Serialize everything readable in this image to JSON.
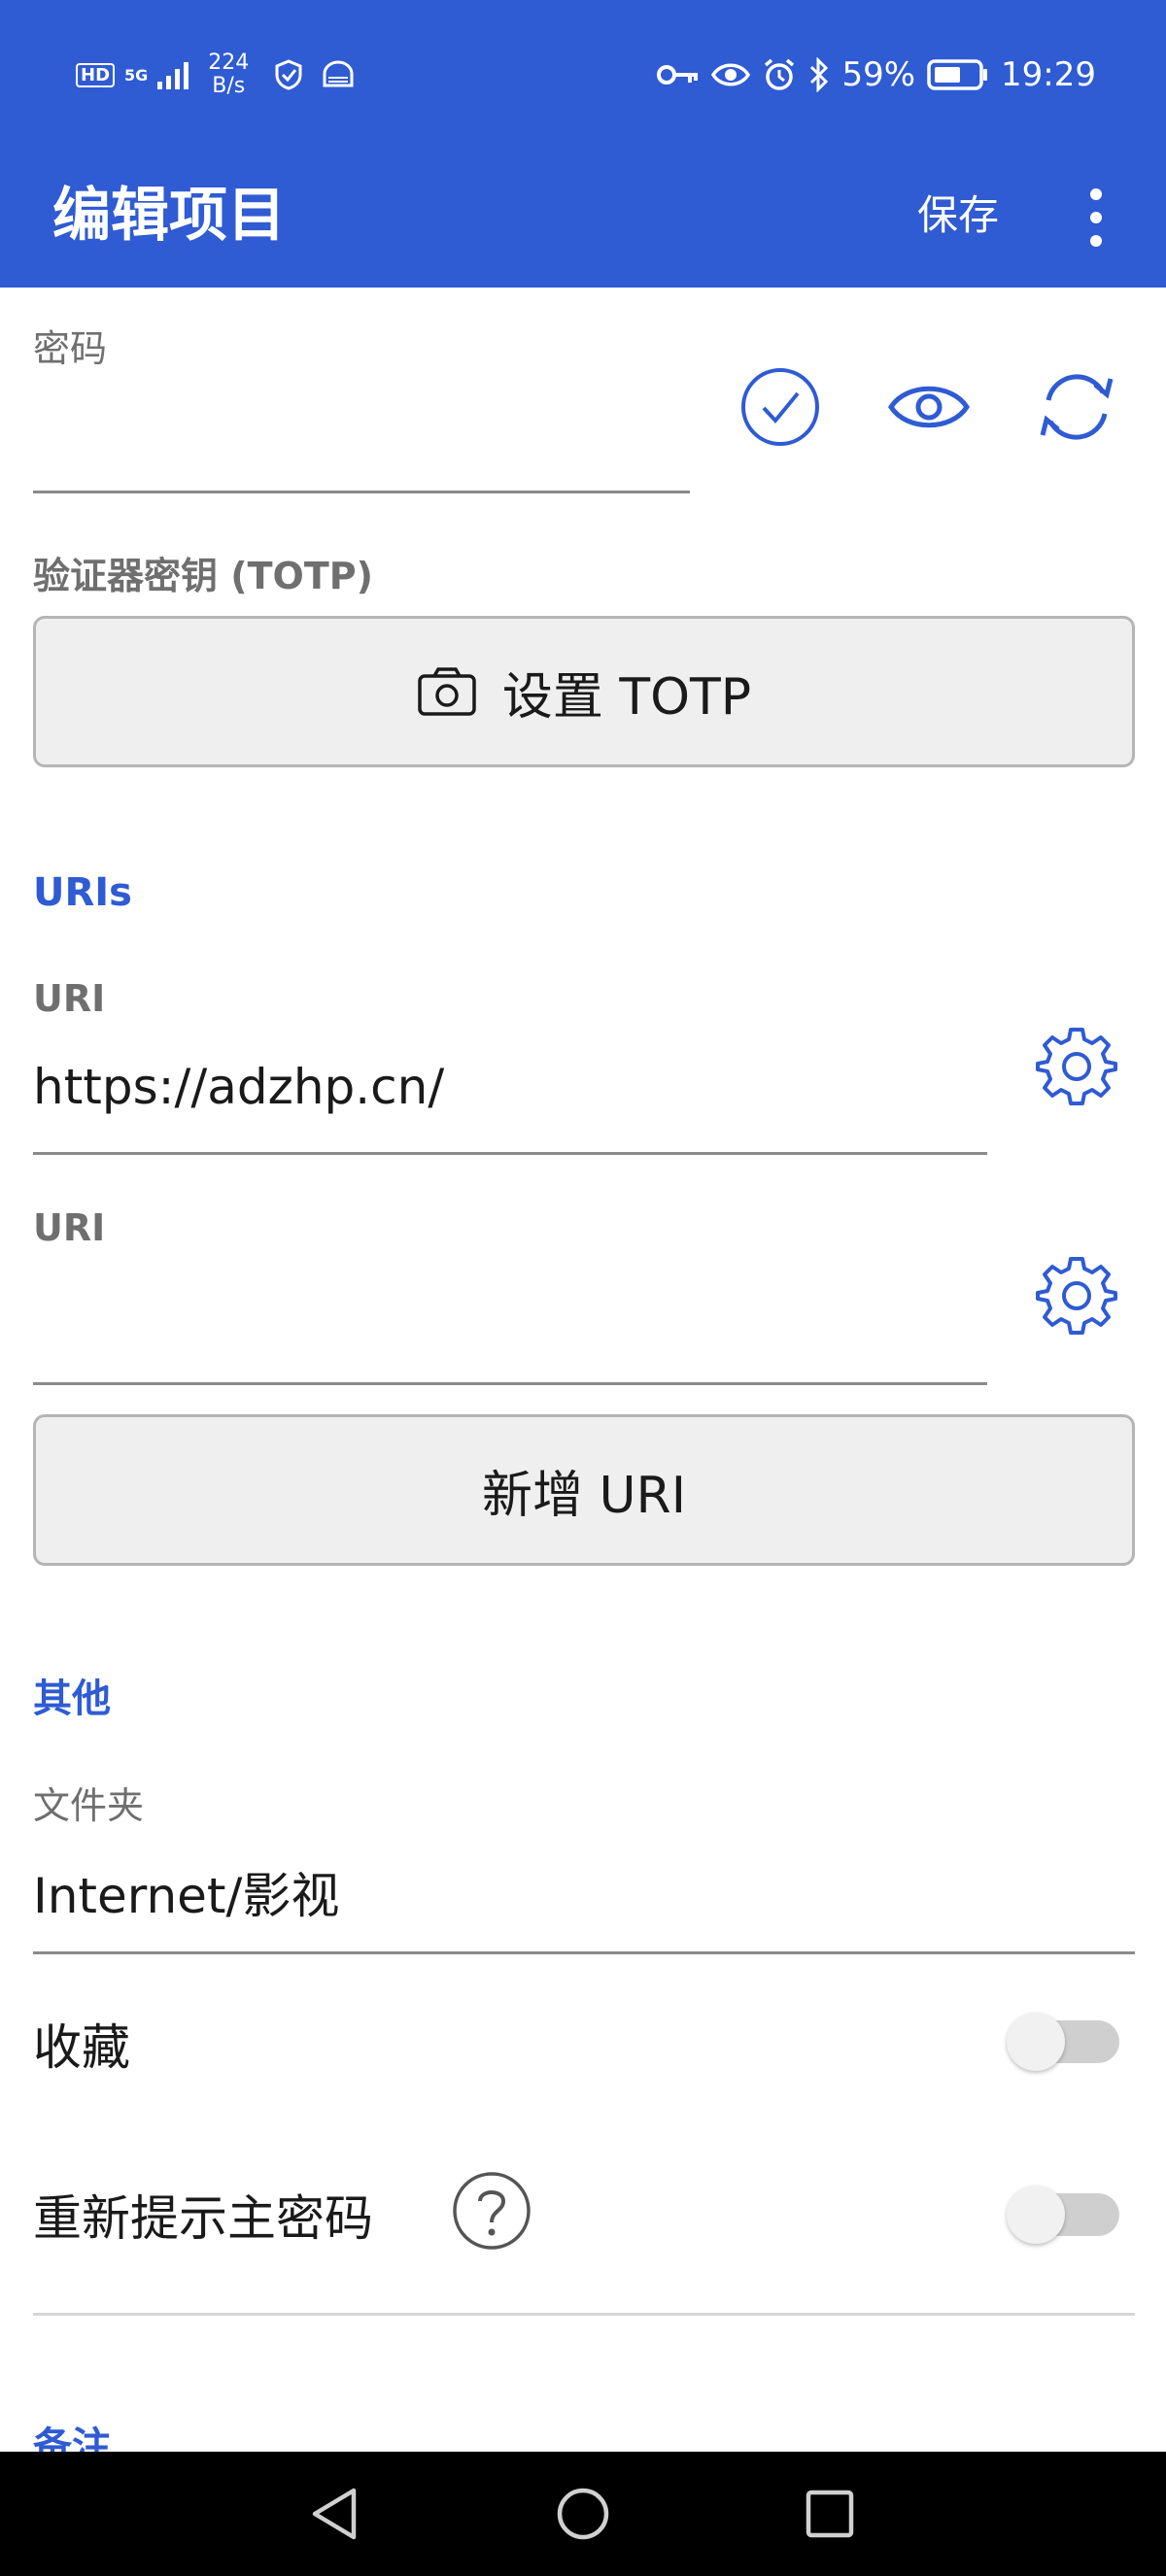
{
  "status_bar": {
    "network": "5G",
    "speed_value": "224",
    "speed_unit": "B/s",
    "battery": "59%",
    "time": "19:29"
  },
  "app_bar": {
    "title": "编辑项目",
    "save_label": "保存"
  },
  "password": {
    "label": "密码",
    "value": ""
  },
  "totp": {
    "label": "验证器密钥 (TOTP)",
    "button_label": "设置 TOTP"
  },
  "uris": {
    "section_title": "URIs",
    "items": [
      {
        "label": "URI",
        "value": "https://adzhp.cn/"
      },
      {
        "label": "URI",
        "value": ""
      }
    ],
    "add_button_label": "新增 URI"
  },
  "other": {
    "section_title": "其他",
    "folder_label": "文件夹",
    "folder_value": "Internet/影视",
    "favorite_label": "收藏",
    "favorite_on": false,
    "reprompt_label": "重新提示主密码",
    "reprompt_on": false
  },
  "notes": {
    "section_title": "备注"
  },
  "colors": {
    "accent": "#2f5bd3",
    "nav_bg": "#000000"
  }
}
